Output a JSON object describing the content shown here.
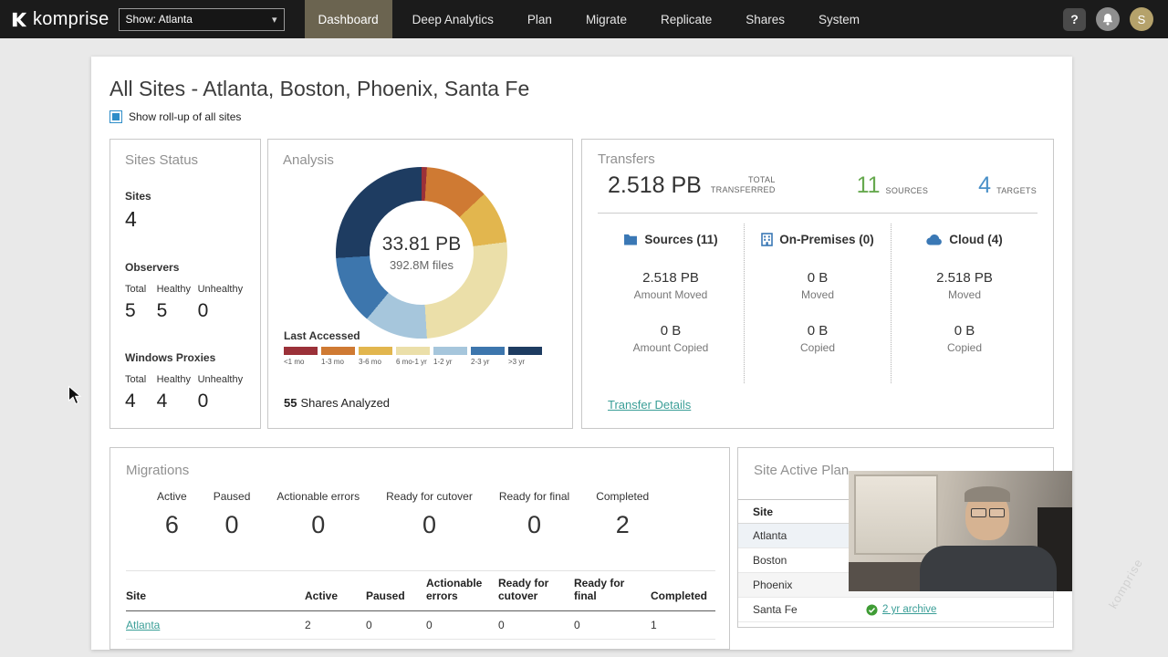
{
  "topbar": {
    "logo": "komprise",
    "site_selector": "Show: Atlanta",
    "tabs": [
      "Dashboard",
      "Deep Analytics",
      "Plan",
      "Migrate",
      "Replicate",
      "Shares",
      "System"
    ],
    "active_tab": "Dashboard",
    "help": "?",
    "avatar": "S"
  },
  "icons": {
    "chevron_down": "▾",
    "bell": "bell-icon",
    "sources": "folder-icon",
    "on_premises": "building-icon",
    "cloud": "cloud-icon",
    "archive_check": "check-circle-icon"
  },
  "colors": {
    "active_tab_bg": "#6b6450",
    "link_teal": "#3a9e97",
    "sources_green": "#67a94f",
    "targets_blue": "#4a90c8",
    "icon_blue": "#3a78b5",
    "check_green": "#3f9c35",
    "checkbox_blue": "#2e8dc8"
  },
  "page": {
    "title": "All Sites - Atlanta, Boston, Phoenix, Santa Fe",
    "rollup_label": "Show roll-up of all sites"
  },
  "sites_status": {
    "title": "Sites Status",
    "sites_label": "Sites",
    "sites_value": "4",
    "groups": [
      {
        "name": "Observers",
        "cols": [
          "Total",
          "Healthy",
          "Unhealthy"
        ],
        "values": [
          "5",
          "5",
          "0"
        ]
      },
      {
        "name": "Windows Proxies",
        "cols": [
          "Total",
          "Healthy",
          "Unhealthy"
        ],
        "values": [
          "4",
          "4",
          "0"
        ]
      }
    ]
  },
  "analysis": {
    "title": "Analysis",
    "center_value": "33.81 PB",
    "center_sub": "392.8M files",
    "legend_title": "Last Accessed",
    "shares_count": "55",
    "shares_label": "Shares Analyzed"
  },
  "chart_data": {
    "type": "pie",
    "donut": true,
    "title": "Analysis — capacity by last accessed age",
    "center_value": "33.81 PB",
    "center_sublabel": "392.8M files",
    "categories": [
      "<1 mo",
      "1-3 mo",
      "3-6 mo",
      "6 mo-1 yr",
      "1-2 yr",
      "2-3 yr",
      ">3 yr"
    ],
    "values_pct": [
      1,
      12,
      10,
      26,
      12,
      13,
      26
    ],
    "colors": [
      "#9b3139",
      "#cf7a33",
      "#e2b64e",
      "#ebdfa9",
      "#a6c6dc",
      "#3d76ad",
      "#1e3c61"
    ],
    "legend_position": "bottom",
    "annotation": "55 Shares Analyzed"
  },
  "transfers": {
    "title": "Transfers",
    "total_value": "2.518 PB",
    "total_label_line1": "TOTAL",
    "total_label_line2": "TRANSFERRED",
    "sources_value": "11",
    "sources_label": "SOURCES",
    "targets_value": "4",
    "targets_label": "TARGETS",
    "columns": [
      {
        "name": "Sources (11)",
        "icon": "folder-icon",
        "value1": "2.518 PB",
        "label1": "Amount Moved",
        "value2": "0 B",
        "label2": "Amount Copied"
      },
      {
        "name": "On-Premises (0)",
        "icon": "building-icon",
        "value1": "0 B",
        "label1": "Moved",
        "value2": "0 B",
        "label2": "Copied"
      },
      {
        "name": "Cloud (4)",
        "icon": "cloud-icon",
        "value1": "2.518 PB",
        "label1": "Moved",
        "value2": "0 B",
        "label2": "Copied"
      }
    ],
    "details_link": "Transfer Details"
  },
  "migrations": {
    "title": "Migrations",
    "stats": [
      {
        "label": "Active",
        "value": "6"
      },
      {
        "label": "Paused",
        "value": "0"
      },
      {
        "label": "Actionable errors",
        "value": "0"
      },
      {
        "label": "Ready for cutover",
        "value": "0"
      },
      {
        "label": "Ready for final",
        "value": "0"
      },
      {
        "label": "Completed",
        "value": "2"
      }
    ],
    "table": {
      "headers": [
        "Site",
        "Active",
        "Paused",
        "Actionable errors",
        "Ready for cutover",
        "Ready for final",
        "Completed"
      ],
      "rows": [
        {
          "site": "Atlanta",
          "values": [
            "2",
            "0",
            "0",
            "0",
            "0",
            "1"
          ]
        }
      ]
    }
  },
  "site_active_plan": {
    "title": "Site Active Plan",
    "col_header": "Site",
    "rows": [
      {
        "site": "Atlanta"
      },
      {
        "site": "Boston"
      },
      {
        "site": "Phoenix"
      },
      {
        "site": "Santa Fe",
        "badge": "2 yr archive"
      }
    ]
  },
  "watermark": "komprise"
}
